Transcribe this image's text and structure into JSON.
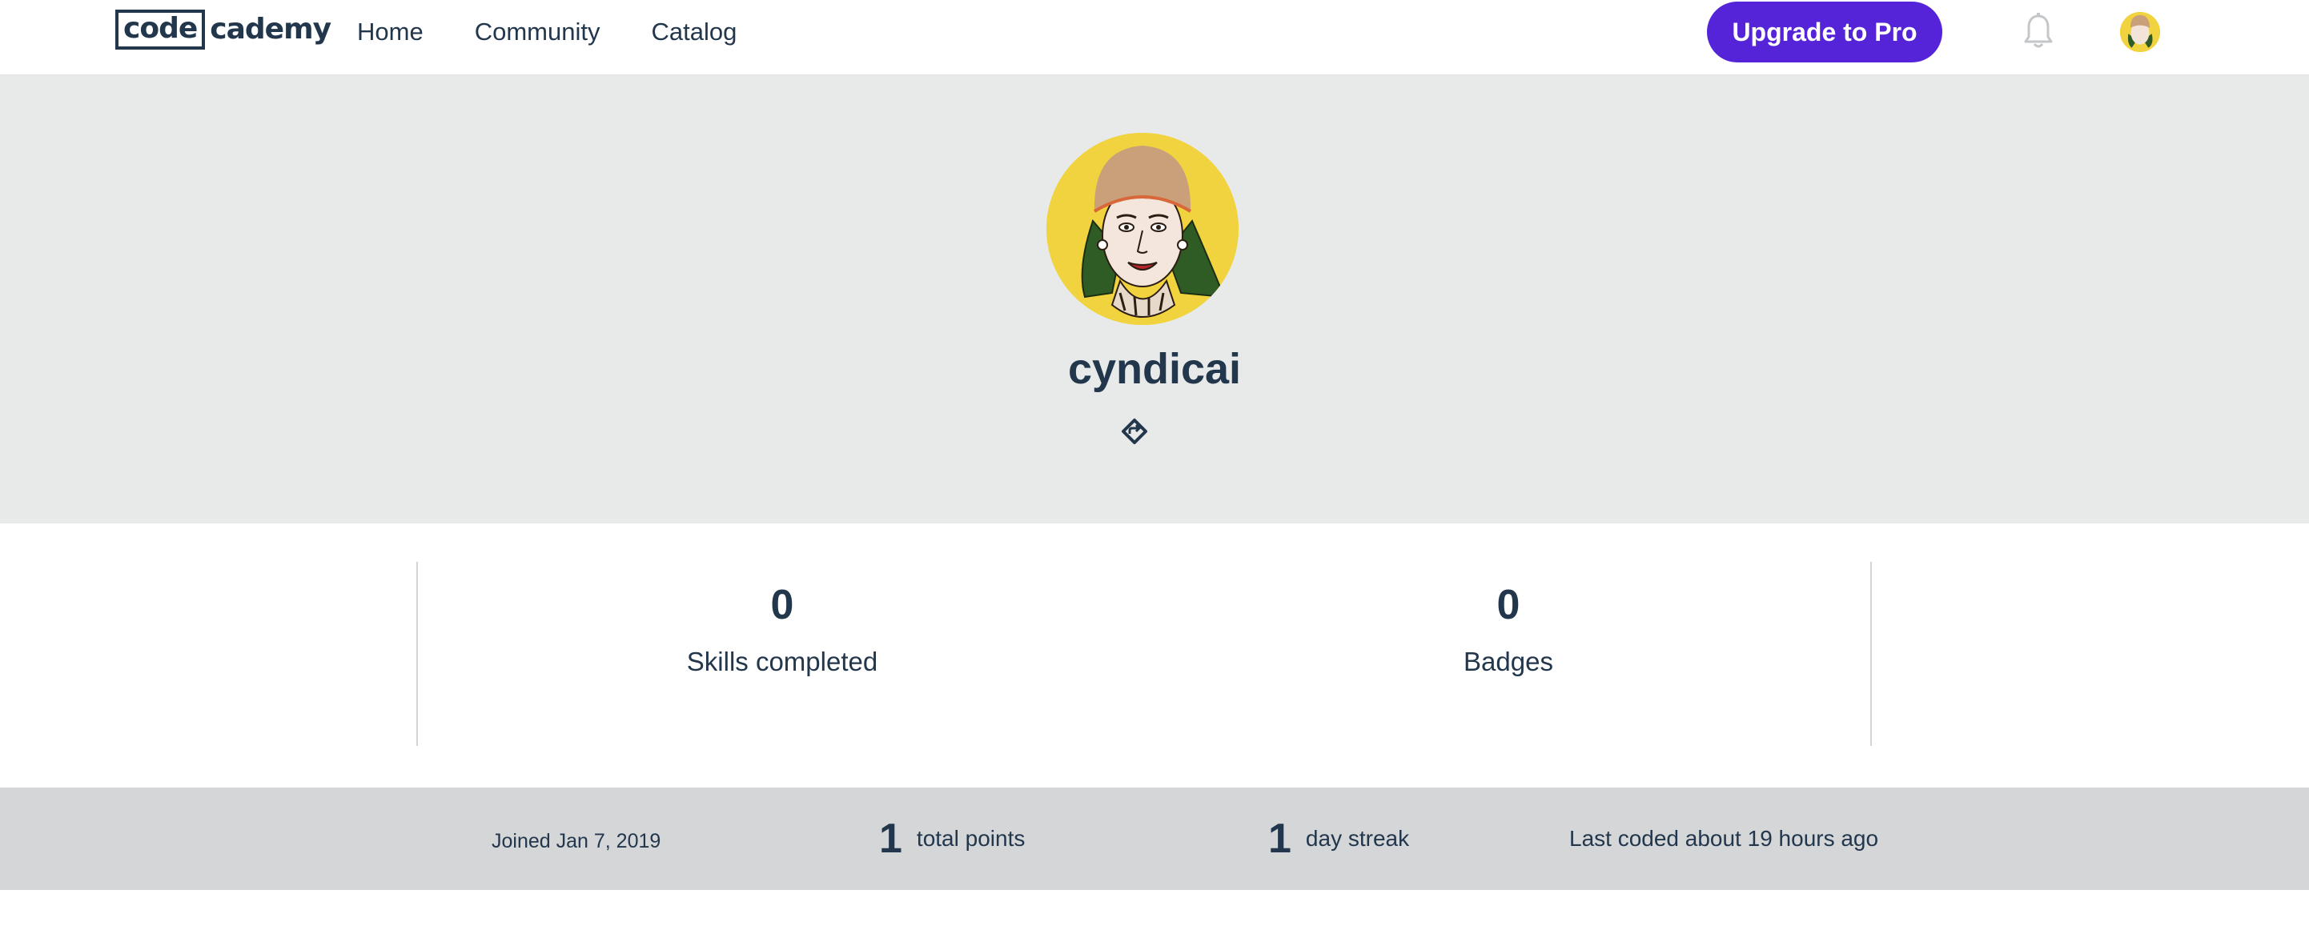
{
  "header": {
    "logo": {
      "part1": "code",
      "part2": "cademy"
    },
    "nav": [
      {
        "label": "Home"
      },
      {
        "label": "Community"
      },
      {
        "label": "Catalog"
      }
    ],
    "upgrade_label": "Upgrade to Pro",
    "icons": {
      "notifications": "bell-icon",
      "account": "user-avatar"
    }
  },
  "profile": {
    "username": "cyndicai",
    "share_icon": "share-icon"
  },
  "stats": [
    {
      "value": "0",
      "label": "Skills completed"
    },
    {
      "value": "0",
      "label": "Badges"
    }
  ],
  "activity": {
    "joined": "Joined Jan 7, 2019",
    "total_points_value": "1",
    "total_points_label": "total points",
    "streak_value": "1",
    "streak_label": "day streak",
    "last_coded": "Last coded about 19 hours ago"
  },
  "colors": {
    "brand_navy": "#22364c",
    "upgrade_purple": "#5524d9",
    "hero_bg": "#e8eaea",
    "footbar_bg": "#d4d6d8",
    "avatar_yellow": "#f0d33e"
  }
}
